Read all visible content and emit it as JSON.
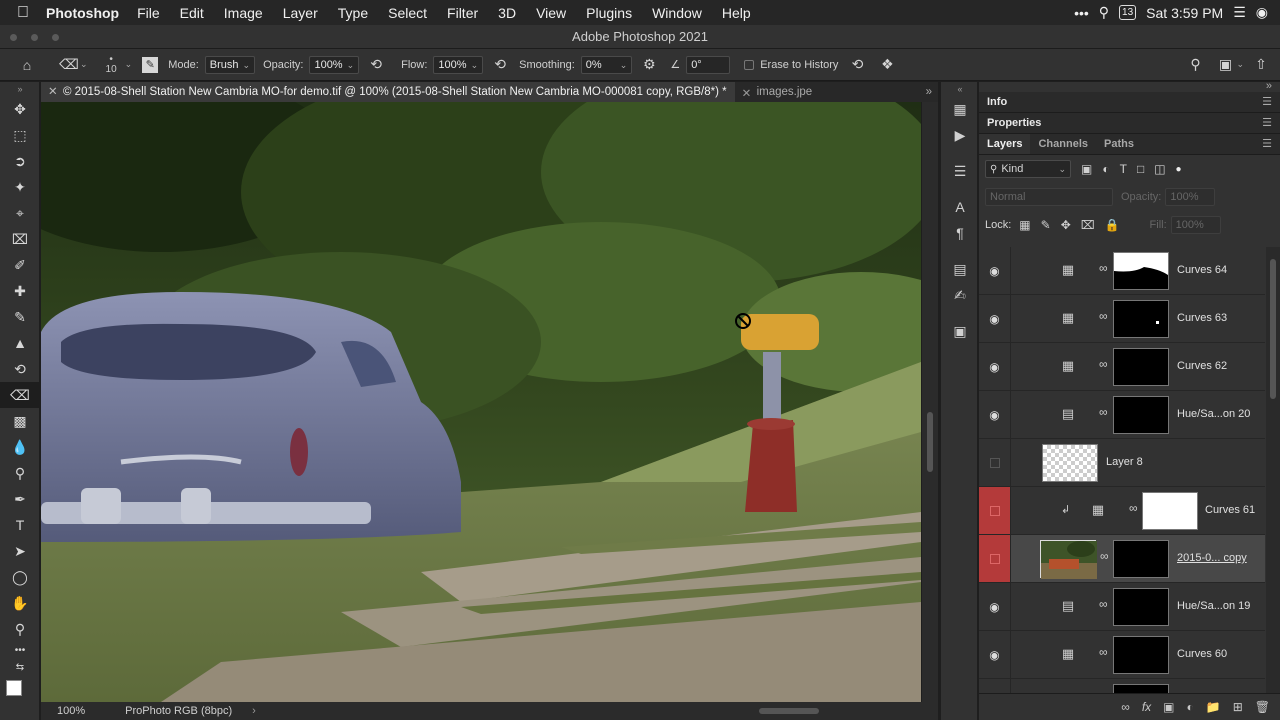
{
  "menubar": {
    "app_name": "Photoshop",
    "menus": [
      "File",
      "Edit",
      "Image",
      "Layer",
      "Type",
      "Select",
      "Filter",
      "3D",
      "View",
      "Plugins",
      "Window",
      "Help"
    ],
    "calendar_day": "13",
    "clock": "Sat 3:59 PM"
  },
  "window_title": "Adobe Photoshop 2021",
  "options": {
    "brush_size": "10",
    "mode_label": "Mode:",
    "mode_value": "Brush",
    "opacity_label": "Opacity:",
    "opacity_value": "100%",
    "flow_label": "Flow:",
    "flow_value": "100%",
    "smoothing_label": "Smoothing:",
    "smoothing_value": "0%",
    "angle_value": "0°",
    "erase_history_label": "Erase to History"
  },
  "doc_tabs": [
    {
      "title": "© 2015-08-Shell Station New Cambria MO-for demo.tif @ 100% (2015-08-Shell Station New Cambria MO-000081 copy, RGB/8*) *"
    },
    {
      "title": "images.jpe"
    }
  ],
  "status": {
    "zoom": "100%",
    "profile": "ProPhoto RGB (8bpc)"
  },
  "panels": {
    "info_title": "Info",
    "properties_title": "Properties",
    "layer_tabs": [
      "Layers",
      "Channels",
      "Paths"
    ],
    "kind_label": "Kind",
    "blend_mode": "Normal",
    "opacity_label": "Opacity:",
    "opacity_value": "100%",
    "lock_label": "Lock:",
    "fill_label": "Fill:",
    "fill_value": "100%"
  },
  "layers": [
    {
      "name": "Curves 64",
      "type": "curves",
      "visible": true,
      "mask": "curves64"
    },
    {
      "name": "Curves 63",
      "type": "curves",
      "visible": true,
      "mask": "dot"
    },
    {
      "name": "Curves 62",
      "type": "curves",
      "visible": true,
      "mask": "black"
    },
    {
      "name": "Hue/Sa...on 20",
      "type": "hue",
      "visible": true,
      "mask": "black"
    },
    {
      "name": "Layer 8",
      "type": "pixel",
      "visible": false,
      "mask": "checker"
    },
    {
      "name": "Curves 61",
      "type": "curves",
      "visible": false,
      "clipped": true,
      "mask": "white",
      "color_tag": "#b43a3a"
    },
    {
      "name": "2015-0... copy",
      "type": "photo",
      "visible": false,
      "selected": true,
      "mask": "black",
      "color_tag": "#b43a3a"
    },
    {
      "name": "Hue/Sa...on 19",
      "type": "hue",
      "visible": true,
      "mask": "black"
    },
    {
      "name": "Curves 60",
      "type": "curves",
      "visible": true,
      "mask": "black"
    }
  ]
}
